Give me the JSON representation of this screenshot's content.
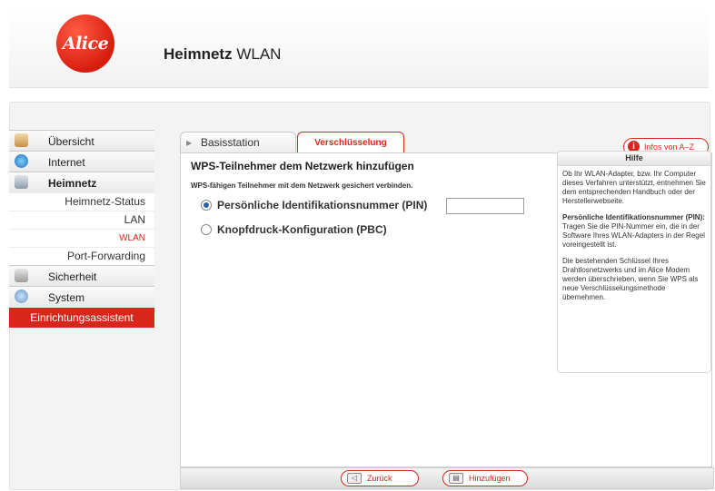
{
  "header": {
    "logo_text": "Alice",
    "title_bold": "Heimnetz",
    "title_rest": "WLAN"
  },
  "sidebar": {
    "items": [
      {
        "label": "Übersicht",
        "icon": "home-icon"
      },
      {
        "label": "Internet",
        "icon": "globe-icon"
      },
      {
        "label": "Heimnetz",
        "icon": "network-icon"
      }
    ],
    "sub_items": [
      "Heimnetz-Status",
      "LAN",
      "WLAN",
      "Port-Forwarding"
    ],
    "items_after": [
      {
        "label": "Sicherheit",
        "icon": "lock-icon"
      },
      {
        "label": "System",
        "icon": "system-icon"
      }
    ],
    "assistant_label": "Einrichtungsassistent"
  },
  "tabs": {
    "base": "Basisstation",
    "encryption": "Verschlüsselung"
  },
  "info_button": "Infos von A–Z",
  "content": {
    "title": "WPS-Teilnehmer dem Netzwerk hinzufügen",
    "subtitle": "WPS-fähigen Teilnehmer mit dem Netzwerk gesichert verbinden.",
    "option_pin": "Persönliche Identifikationsnummer (PIN)",
    "option_pbc": "Knopfdruck-Konfiguration (PBC)",
    "pin_value": ""
  },
  "help": {
    "title": "Hilfe",
    "p1": "Ob Ihr WLAN-Adapter, bzw. Ihr Computer dieses Verfahren unterstützt, entnehmen Sie dem entsprechenden Handbuch oder der Herstellerwebseite.",
    "p2_heading": "Persönliche Identifikationsnummer (PIN):",
    "p2": "Tragen Sie die PIN-Nummer ein, die in der Software Ihres WLAN-Adapters in der Regel voreingestellt ist.",
    "p3": "Die bestehenden Schlüssel Ihres Drahtlosnetzwerks und im Alice Modem werden überschrieben, wenn Sie WPS als neue Verschlüsselungsmethode übernehmen."
  },
  "footer": {
    "back": "Zurück",
    "add": "Hinzufügen"
  },
  "colors": {
    "accent": "#d8261a"
  }
}
